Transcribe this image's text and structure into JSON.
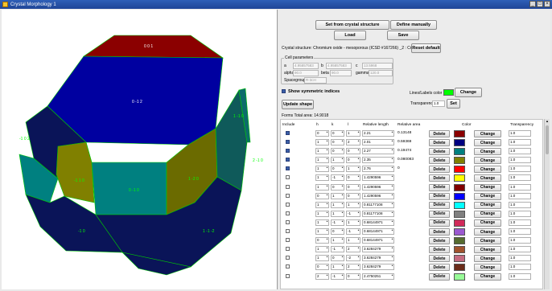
{
  "window": {
    "title": "Crystal Morphology 1"
  },
  "viewer": {
    "face_labels": [
      "0 0 1",
      "0 -1 2",
      "-1 0 2",
      "1 -1 0",
      "-1 1 0",
      "1 -2 0",
      "0 -1 0",
      "-1 0",
      "1 -1 -2",
      "2 -1 0"
    ]
  },
  "panel": {
    "set_from_structure": "Set from crystal structure",
    "define_manually": "Define manually",
    "load": "Load",
    "save": "Save",
    "structure_text": "Crystal structure: Chromium oxide - mesoporous (ICSD #167266) _2 : Cr2O3",
    "reset_default": "Reset default",
    "cell_title": "Cell parameters",
    "a_label": "a",
    "a_value": "4.95857583",
    "b_label": "b",
    "b_value": "4.95857583",
    "c_label": "c",
    "c_value": "13.5968",
    "alpha_label": "alpha",
    "alpha_value": "90.0",
    "beta_label": "beta",
    "beta_value": "90.0",
    "gamma_label": "gamma",
    "gamma_value": "120.0",
    "spacegroup_label": "Spacegroup",
    "spacegroup_value": "R-3cH",
    "show_symmetric": "Show symmetric indices",
    "lines_labels_color": "Lines/Labels color",
    "change": "Change",
    "update_shape": "Update shape",
    "transparency_label": "Transparency",
    "transparency_value": "1.0",
    "set": "Set",
    "forms_header": "Forms   Total area: 14.9018",
    "colors": {
      "lines": "#00ff00",
      "checkbox": "#3a5fa8"
    }
  },
  "table": {
    "headers": [
      "Include",
      "h",
      "k",
      "l",
      "Relative length",
      "Relative area",
      "Color",
      "Transparency"
    ],
    "delete_label": "Delete",
    "change_label": "Change",
    "rows": [
      {
        "include": true,
        "h": "0",
        "k": "0",
        "l": "1",
        "len": "2.21",
        "area": "0.13148",
        "color": "#8b0000",
        "t": "1.0"
      },
      {
        "include": true,
        "h": "1",
        "k": "0",
        "l": "2",
        "len": "2.01",
        "area": "0.59369",
        "color": "#000080",
        "t": "1.0"
      },
      {
        "include": true,
        "h": "1",
        "k": "0",
        "l": "0",
        "len": "2.27",
        "area": "0.19474",
        "color": "#008080",
        "t": "1.0"
      },
      {
        "include": true,
        "h": "1",
        "k": "1",
        "l": "0",
        "len": "2.35",
        "area": "0.080083",
        "color": "#808000",
        "t": "1.0"
      },
      {
        "include": true,
        "h": "1",
        "k": "0",
        "l": "1",
        "len": "2.76",
        "area": "0",
        "color": "#ff0000",
        "t": "1.0"
      },
      {
        "include": false,
        "h": "1",
        "k": "-1",
        "l": "0",
        "len": "1.4290596",
        "area": "",
        "color": "#ffff00",
        "t": "1.0"
      },
      {
        "include": false,
        "h": "1",
        "k": "0",
        "l": "0",
        "len": "1.4290596",
        "area": "",
        "color": "#800000",
        "t": "1.0"
      },
      {
        "include": false,
        "h": "0",
        "k": "1",
        "l": "0",
        "len": "1.4290596",
        "area": "",
        "color": "#0000ff",
        "t": "1.0"
      },
      {
        "include": false,
        "h": "1",
        "k": "1",
        "l": "1",
        "len": "0.81177108",
        "area": "",
        "color": "#00ffff",
        "t": "1.0"
      },
      {
        "include": false,
        "h": "1",
        "k": "1",
        "l": "-1",
        "len": "0.81177108",
        "area": "",
        "color": "#808080",
        "t": "1.0"
      },
      {
        "include": false,
        "h": "1",
        "k": "-1",
        "l": "1",
        "len": "0.68144971",
        "area": "",
        "color": "#d12a5a",
        "t": "1.0"
      },
      {
        "include": false,
        "h": "1",
        "k": "0",
        "l": "-1",
        "len": "0.68144971",
        "area": "",
        "color": "#9b59d0",
        "t": "1.0"
      },
      {
        "include": false,
        "h": "0",
        "k": "1",
        "l": "1",
        "len": "0.68144971",
        "area": "",
        "color": "#556b2f",
        "t": "1.0"
      },
      {
        "include": false,
        "h": "1",
        "k": "-1",
        "l": "2",
        "len": "3.6284279",
        "area": "",
        "color": "#a0522d",
        "t": "1.0"
      },
      {
        "include": false,
        "h": "1",
        "k": "0",
        "l": "-2",
        "len": "3.6284279",
        "area": "",
        "color": "#c46a80",
        "t": "1.0"
      },
      {
        "include": false,
        "h": "0",
        "k": "1",
        "l": "2",
        "len": "3.6284279",
        "area": "",
        "color": "#6b2c1a",
        "t": "1.0"
      },
      {
        "include": false,
        "h": "2",
        "k": "-1",
        "l": "0",
        "len": "2.4750251",
        "area": "",
        "color": "#98fb98",
        "t": "1.0"
      }
    ]
  }
}
